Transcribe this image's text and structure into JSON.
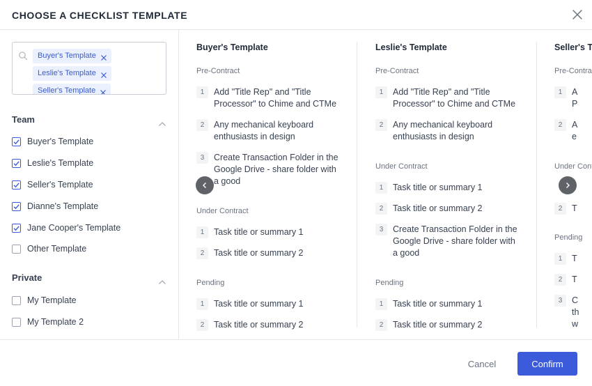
{
  "header": {
    "title": "CHOOSE A CHECKLIST TEMPLATE"
  },
  "search": {
    "chips": [
      "Buyer's Template",
      "Leslie's Template",
      "Seller's Template"
    ]
  },
  "sidebar": {
    "team": {
      "title": "Team",
      "items": [
        {
          "label": "Buyer's Template",
          "checked": true
        },
        {
          "label": "Leslie's Template",
          "checked": true
        },
        {
          "label": "Seller's Template",
          "checked": true
        },
        {
          "label": "Dianne's Template",
          "checked": true
        },
        {
          "label": "Jane Cooper's Template",
          "checked": true
        },
        {
          "label": "Other Template",
          "checked": false
        }
      ]
    },
    "private": {
      "title": "Private",
      "items": [
        {
          "label": "My Template",
          "checked": false
        },
        {
          "label": "My Template 2",
          "checked": false
        }
      ]
    }
  },
  "templates": [
    {
      "title": "Buyer's Template",
      "pre_contract": {
        "label": "Pre-Contract",
        "tasks": [
          {
            "num": "1",
            "text": "Add \"Title Rep\" and \"Title Processor\" to Chime and CTMe"
          },
          {
            "num": "2",
            "text": "Any mechanical keyboard enthusiasts in design"
          },
          {
            "num": "3",
            "text": "Create Transaction Folder in the Google Drive - share folder with a good"
          }
        ]
      },
      "under_contract": {
        "label": "Under Contract",
        "tasks": [
          {
            "num": "1",
            "text": "Task title or summary 1"
          },
          {
            "num": "2",
            "text": "Task title or summary 2"
          }
        ]
      },
      "pending": {
        "label": "Pending",
        "tasks": [
          {
            "num": "1",
            "text": "Task title or summary 1"
          },
          {
            "num": "2",
            "text": "Task title or summary 2"
          }
        ]
      }
    },
    {
      "title": "Leslie's Template",
      "pre_contract": {
        "label": "Pre-Contract",
        "tasks": [
          {
            "num": "1",
            "text": "Add \"Title Rep\" and \"Title Processor\" to Chime and CTMe"
          },
          {
            "num": "2",
            "text": "Any mechanical keyboard enthusiasts in design"
          }
        ]
      },
      "under_contract": {
        "label": "Under Contract",
        "tasks": [
          {
            "num": "1",
            "text": "Task title or summary 1"
          },
          {
            "num": "2",
            "text": "Task title or summary 2"
          },
          {
            "num": "3",
            "text": "Create Transaction Folder in the Google Drive - share folder with a good"
          }
        ]
      },
      "pending": {
        "label": "Pending",
        "tasks": [
          {
            "num": "1",
            "text": "Task title or summary 1"
          },
          {
            "num": "2",
            "text": "Task title or summary 2"
          }
        ]
      }
    },
    {
      "title": "Seller's Template",
      "pre_contract": {
        "label": "Pre-Contract",
        "tasks": [
          {
            "num": "1",
            "text": "A P"
          },
          {
            "num": "2",
            "text": "A e"
          }
        ]
      },
      "under_contract": {
        "label": "Under Contract",
        "tasks": [
          {
            "num": "2",
            "text": "T"
          }
        ]
      },
      "pending": {
        "label": "Pending",
        "tasks": [
          {
            "num": "1",
            "text": "T"
          },
          {
            "num": "2",
            "text": "T"
          },
          {
            "num": "3",
            "text": "C th w"
          }
        ]
      }
    }
  ],
  "footer": {
    "cancel_label": "Cancel",
    "confirm_label": "Confirm"
  },
  "colors": {
    "primary": "#3b5bdb",
    "chip_bg": "#eaf0fd",
    "chip_text": "#3b5bcc",
    "checkbox": "#3b5bdb",
    "nav_arrow": "#5f6368"
  }
}
